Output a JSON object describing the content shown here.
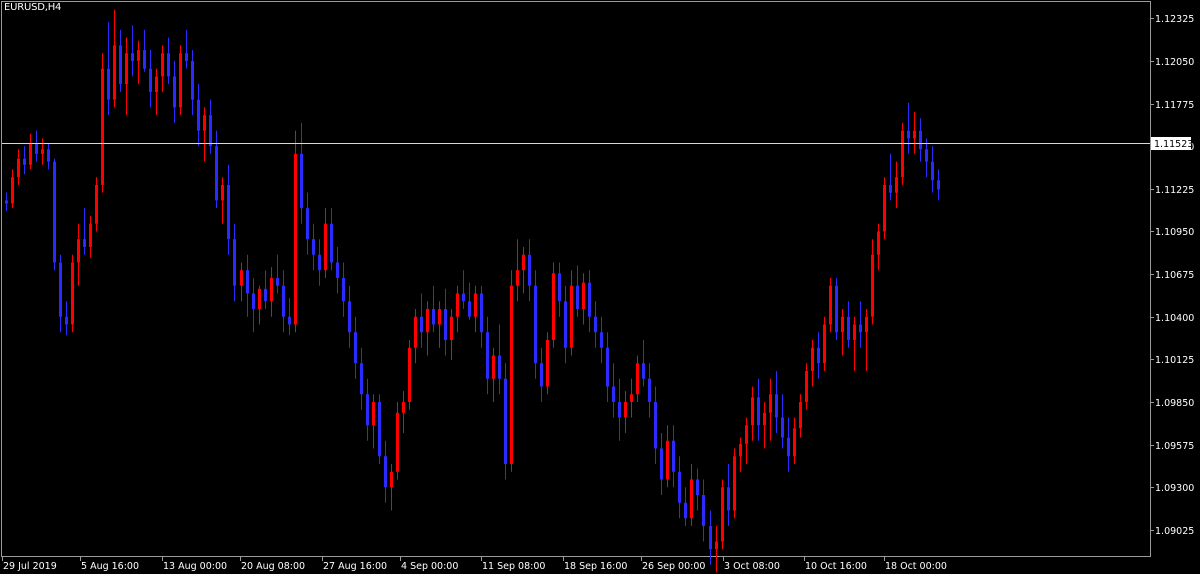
{
  "header": {
    "symbol": "EURUSD,H4"
  },
  "current_price": "1.11523",
  "colors": {
    "bull": "#ff0000",
    "bear": "#2b2bff",
    "neutral": "#22bb22",
    "background": "#000000",
    "foreground": "#ffffff"
  },
  "chart_data": {
    "type": "candlestick",
    "title": "EURUSD,H4",
    "y_ticks": [
      "1.12325",
      "1.12050",
      "1.11775",
      "1.11500",
      "1.11225",
      "1.10950",
      "1.10675",
      "1.10400",
      "1.10125",
      "1.09850",
      "1.09575",
      "1.09300",
      "1.09025"
    ],
    "x_ticks": [
      "29 Jul 2019",
      "5 Aug 16:00",
      "13 Aug 00:00",
      "20 Aug 08:00",
      "27 Aug 16:00",
      "4 Sep 00:00",
      "11 Sep 08:00",
      "18 Sep 16:00",
      "26 Sep 00:00",
      "3 Oct 08:00",
      "10 Oct 16:00",
      "18 Oct 00:00"
    ],
    "ylim": [
      1.0885,
      1.1243
    ],
    "horizontal_line": 1.11523,
    "candles": [
      [
        1.1115,
        1.112,
        1.1108,
        1.1113
      ],
      [
        1.1113,
        1.1135,
        1.111,
        1.113
      ],
      [
        1.113,
        1.1148,
        1.1125,
        1.1142
      ],
      [
        1.1142,
        1.115,
        1.1132,
        1.1138
      ],
      [
        1.1138,
        1.1158,
        1.1135,
        1.1152
      ],
      [
        1.1152,
        1.116,
        1.114,
        1.1145
      ],
      [
        1.1145,
        1.1155,
        1.1138,
        1.1148
      ],
      [
        1.1148,
        1.1152,
        1.1135,
        1.114
      ],
      [
        1.114,
        1.1142,
        1.107,
        1.1075
      ],
      [
        1.1075,
        1.108,
        1.103,
        1.104
      ],
      [
        1.104,
        1.105,
        1.1028,
        1.1035
      ],
      [
        1.1035,
        1.108,
        1.103,
        1.1075
      ],
      [
        1.1075,
        1.11,
        1.106,
        1.109
      ],
      [
        1.109,
        1.111,
        1.108,
        1.1085
      ],
      [
        1.1085,
        1.1105,
        1.1078,
        1.11
      ],
      [
        1.11,
        1.113,
        1.1095,
        1.1125
      ],
      [
        1.1125,
        1.121,
        1.112,
        1.12
      ],
      [
        1.12,
        1.123,
        1.117,
        1.118
      ],
      [
        1.118,
        1.1238,
        1.1175,
        1.1215
      ],
      [
        1.1215,
        1.1225,
        1.1185,
        1.119
      ],
      [
        1.119,
        1.122,
        1.117,
        1.121
      ],
      [
        1.121,
        1.1228,
        1.1195,
        1.1205
      ],
      [
        1.1205,
        1.1218,
        1.119,
        1.1212
      ],
      [
        1.1212,
        1.1225,
        1.1198,
        1.12
      ],
      [
        1.12,
        1.1212,
        1.1175,
        1.1185
      ],
      [
        1.1185,
        1.12,
        1.117,
        1.1195
      ],
      [
        1.1195,
        1.1215,
        1.1185,
        1.121
      ],
      [
        1.121,
        1.122,
        1.119,
        1.1195
      ],
      [
        1.1195,
        1.1205,
        1.1165,
        1.1175
      ],
      [
        1.1175,
        1.1215,
        1.117,
        1.121
      ],
      [
        1.121,
        1.1225,
        1.12,
        1.1205
      ],
      [
        1.1205,
        1.1212,
        1.117,
        1.118
      ],
      [
        1.118,
        1.119,
        1.115,
        1.116
      ],
      [
        1.116,
        1.1175,
        1.114,
        1.117
      ],
      [
        1.117,
        1.118,
        1.1145,
        1.115
      ],
      [
        1.115,
        1.116,
        1.111,
        1.1115
      ],
      [
        1.1115,
        1.113,
        1.11,
        1.1125
      ],
      [
        1.1125,
        1.1138,
        1.108,
        1.109
      ],
      [
        1.109,
        1.11,
        1.105,
        1.106
      ],
      [
        1.106,
        1.1075,
        1.105,
        1.107
      ],
      [
        1.107,
        1.108,
        1.104,
        1.1055
      ],
      [
        1.1055,
        1.1065,
        1.103,
        1.1045
      ],
      [
        1.1045,
        1.106,
        1.1035,
        1.1058
      ],
      [
        1.1058,
        1.107,
        1.1045,
        1.105
      ],
      [
        1.105,
        1.1072,
        1.104,
        1.1065
      ],
      [
        1.1065,
        1.108,
        1.1055,
        1.106
      ],
      [
        1.106,
        1.107,
        1.103,
        1.104
      ],
      [
        1.104,
        1.1052,
        1.1028,
        1.1035
      ],
      [
        1.1035,
        1.116,
        1.103,
        1.1145
      ],
      [
        1.1145,
        1.1165,
        1.11,
        1.111
      ],
      [
        1.111,
        1.112,
        1.108,
        1.109
      ],
      [
        1.109,
        1.11,
        1.107,
        1.108
      ],
      [
        1.108,
        1.109,
        1.106,
        1.107
      ],
      [
        1.107,
        1.111,
        1.1065,
        1.11
      ],
      [
        1.11,
        1.111,
        1.107,
        1.1075
      ],
      [
        1.1075,
        1.1085,
        1.1055,
        1.1065
      ],
      [
        1.1065,
        1.1075,
        1.104,
        1.105
      ],
      [
        1.105,
        1.106,
        1.102,
        1.103
      ],
      [
        1.103,
        1.104,
        1.1,
        1.101
      ],
      [
        1.101,
        1.102,
        1.098,
        1.099
      ],
      [
        1.099,
        1.1,
        1.096,
        1.097
      ],
      [
        1.097,
        1.099,
        1.0955,
        1.0985
      ],
      [
        1.0985,
        1.099,
        1.0945,
        1.095
      ],
      [
        1.095,
        1.096,
        1.092,
        1.093
      ],
      [
        1.093,
        1.0945,
        1.0915,
        1.094
      ],
      [
        1.094,
        1.0985,
        1.0935,
        1.0978
      ],
      [
        1.0978,
        1.0992,
        1.0965,
        1.0985
      ],
      [
        1.0985,
        1.1025,
        1.098,
        1.102
      ],
      [
        1.102,
        1.1045,
        1.101,
        1.104
      ],
      [
        1.104,
        1.1055,
        1.102,
        1.103
      ],
      [
        1.103,
        1.105,
        1.1015,
        1.1045
      ],
      [
        1.1045,
        1.106,
        1.103,
        1.1035
      ],
      [
        1.1035,
        1.105,
        1.102,
        1.1045
      ],
      [
        1.1045,
        1.1058,
        1.1015,
        1.1025
      ],
      [
        1.1025,
        1.1045,
        1.1012,
        1.104
      ],
      [
        1.104,
        1.106,
        1.103,
        1.1055
      ],
      [
        1.1055,
        1.107,
        1.1045,
        1.105
      ],
      [
        1.105,
        1.1062,
        1.1038,
        1.104
      ],
      [
        1.104,
        1.106,
        1.103,
        1.1055
      ],
      [
        1.1055,
        1.106,
        1.102,
        1.103
      ],
      [
        1.103,
        1.104,
        1.099,
        1.1
      ],
      [
        1.1,
        1.102,
        1.0985,
        1.1015
      ],
      [
        1.1015,
        1.1035,
        1.099,
        1.1
      ],
      [
        1.1,
        1.101,
        1.0935,
        1.0945
      ],
      [
        1.0945,
        1.107,
        1.094,
        1.106
      ],
      [
        1.106,
        1.109,
        1.105,
        1.107
      ],
      [
        1.107,
        1.1085,
        1.1055,
        1.108
      ],
      [
        1.108,
        1.109,
        1.105,
        1.106
      ],
      [
        1.106,
        1.107,
        1.1,
        1.101
      ],
      [
        1.101,
        1.102,
        1.0985,
        1.0995
      ],
      [
        1.0995,
        1.103,
        1.099,
        1.1025
      ],
      [
        1.1025,
        1.1075,
        1.102,
        1.1068
      ],
      [
        1.1068,
        1.1075,
        1.104,
        1.105
      ],
      [
        1.105,
        1.106,
        1.101,
        1.102
      ],
      [
        1.102,
        1.107,
        1.1015,
        1.106
      ],
      [
        1.106,
        1.1073,
        1.104,
        1.1045
      ],
      [
        1.1045,
        1.1068,
        1.1035,
        1.1062
      ],
      [
        1.1062,
        1.107,
        1.103,
        1.104
      ],
      [
        1.104,
        1.105,
        1.102,
        1.103
      ],
      [
        1.103,
        1.104,
        1.101,
        1.102
      ],
      [
        1.102,
        1.103,
        1.0985,
        1.0995
      ],
      [
        1.0995,
        1.101,
        1.0975,
        1.0985
      ],
      [
        1.0985,
        1.1,
        1.096,
        1.0975
      ],
      [
        1.0975,
        1.0992,
        1.0965,
        1.0985
      ],
      [
        1.0985,
        1.1,
        1.0975,
        1.099
      ],
      [
        1.099,
        1.1015,
        1.0985,
        1.101
      ],
      [
        1.101,
        1.1025,
        1.0995,
        1.1
      ],
      [
        1.1,
        1.101,
        1.0975,
        1.0985
      ],
      [
        1.0985,
        1.0995,
        1.0945,
        1.0955
      ],
      [
        1.0955,
        1.0965,
        1.0925,
        1.0935
      ],
      [
        1.0935,
        1.097,
        1.093,
        1.096
      ],
      [
        1.096,
        1.097,
        1.093,
        1.094
      ],
      [
        1.094,
        1.095,
        1.091,
        1.092
      ],
      [
        1.092,
        1.093,
        1.0905,
        1.091
      ],
      [
        1.091,
        1.0945,
        1.0905,
        1.0935
      ],
      [
        1.0935,
        1.0942,
        1.0915,
        1.0925
      ],
      [
        1.0925,
        1.0935,
        1.0895,
        1.0905
      ],
      [
        1.0905,
        1.0915,
        1.088,
        1.089
      ],
      [
        1.089,
        1.0905,
        1.0875,
        1.0895
      ],
      [
        1.0895,
        1.0935,
        1.089,
        1.093
      ],
      [
        1.093,
        1.0945,
        1.0905,
        1.0915
      ],
      [
        1.0915,
        1.0955,
        1.091,
        1.095
      ],
      [
        1.095,
        1.0962,
        1.094,
        1.0958
      ],
      [
        1.0958,
        1.0975,
        1.0945,
        1.097
      ],
      [
        1.097,
        1.0995,
        1.096,
        1.0988
      ],
      [
        1.0988,
        1.1,
        1.096,
        1.097
      ],
      [
        1.097,
        1.0985,
        1.0955,
        1.0978
      ],
      [
        1.0978,
        1.1,
        1.096,
        1.099
      ],
      [
        1.099,
        1.1005,
        1.0965,
        1.0975
      ],
      [
        1.0975,
        1.099,
        1.0955,
        1.0962
      ],
      [
        1.0962,
        1.0975,
        1.094,
        1.095
      ],
      [
        1.095,
        1.0975,
        1.0945,
        1.0968
      ],
      [
        1.0968,
        1.099,
        1.0962,
        1.0985
      ],
      [
        1.0985,
        1.101,
        1.098,
        1.1005
      ],
      [
        1.1005,
        1.1025,
        1.0995,
        1.102
      ],
      [
        1.102,
        1.103,
        1.1,
        1.101
      ],
      [
        1.101,
        1.104,
        1.1005,
        1.1035
      ],
      [
        1.1035,
        1.1065,
        1.103,
        1.106
      ],
      [
        1.106,
        1.1065,
        1.1025,
        1.103
      ],
      [
        1.103,
        1.1045,
        1.1015,
        1.104
      ],
      [
        1.104,
        1.105,
        1.102,
        1.1025
      ],
      [
        1.1025,
        1.104,
        1.1005,
        1.1035
      ],
      [
        1.1035,
        1.105,
        1.102,
        1.103
      ],
      [
        1.103,
        1.1045,
        1.1005,
        1.104
      ],
      [
        1.104,
        1.109,
        1.1035,
        1.108
      ],
      [
        1.108,
        1.11,
        1.107,
        1.1095
      ],
      [
        1.1095,
        1.113,
        1.109,
        1.1125
      ],
      [
        1.1125,
        1.1145,
        1.1115,
        1.112
      ],
      [
        1.112,
        1.114,
        1.111,
        1.113
      ],
      [
        1.113,
        1.1165,
        1.1125,
        1.116
      ],
      [
        1.116,
        1.1178,
        1.1145,
        1.1155
      ],
      [
        1.1155,
        1.1172,
        1.1145,
        1.116
      ],
      [
        1.116,
        1.1168,
        1.114,
        1.1148
      ],
      [
        1.1148,
        1.1155,
        1.113,
        1.114
      ],
      [
        1.114,
        1.115,
        1.112,
        1.1128
      ],
      [
        1.1128,
        1.1135,
        1.1115,
        1.1122
      ]
    ]
  }
}
